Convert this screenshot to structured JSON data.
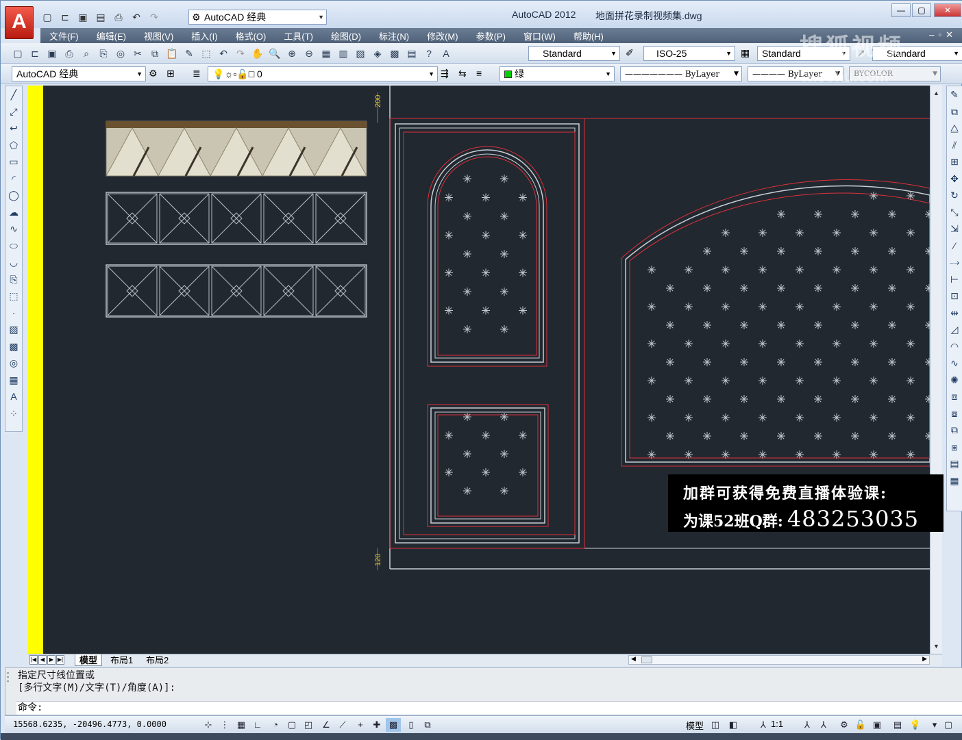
{
  "app": {
    "name": "AutoCAD 2012",
    "file": "地面拼花录制视频集.dwg",
    "logo_letter": "A",
    "workspace": "AutoCAD 经典"
  },
  "menu": [
    "文件(F)",
    "编辑(E)",
    "视图(V)",
    "插入(I)",
    "格式(O)",
    "工具(T)",
    "绘图(D)",
    "标注(N)",
    "修改(M)",
    "参数(P)",
    "窗口(W)",
    "帮助(H)"
  ],
  "watermark": {
    "line1": "搜狐视频",
    "line2": "tv.sohu.com"
  },
  "styles_toolbar": {
    "text_style": "Standard",
    "dim_style": "ISO-25",
    "table_style": "Standard",
    "mleader_style": "Standard"
  },
  "layers_toolbar": {
    "workspace": "AutoCAD 经典",
    "layer": "0",
    "color": "绿",
    "linetype": "ByLayer",
    "lineweight": "ByLayer",
    "plotstyle": "BYCOLOR"
  },
  "drawing": {
    "dim_top": "200",
    "dim_bottom": "120"
  },
  "tabs": {
    "model": "模型",
    "layout1": "布局1",
    "layout2": "布局2"
  },
  "command": {
    "history_line1": "指定尺寸线位置或",
    "history_line2": "[多行文字(M)/文字(T)/角度(A)]:",
    "prompt": "命令:"
  },
  "status": {
    "coords": "15568.6235,  -20496.4773,  0.0000",
    "model_label": "模型",
    "scale": "1:1"
  },
  "promo": {
    "line1": "加群可获得免费直播体验课:",
    "line2_prefix": "为课52班Q群:",
    "qq": "483253035"
  },
  "colors": {
    "canvas": "#212830",
    "accent_yellow": "#ffff00",
    "drawing_red": "#e0303a",
    "drawing_gray": "#b9bec5"
  }
}
